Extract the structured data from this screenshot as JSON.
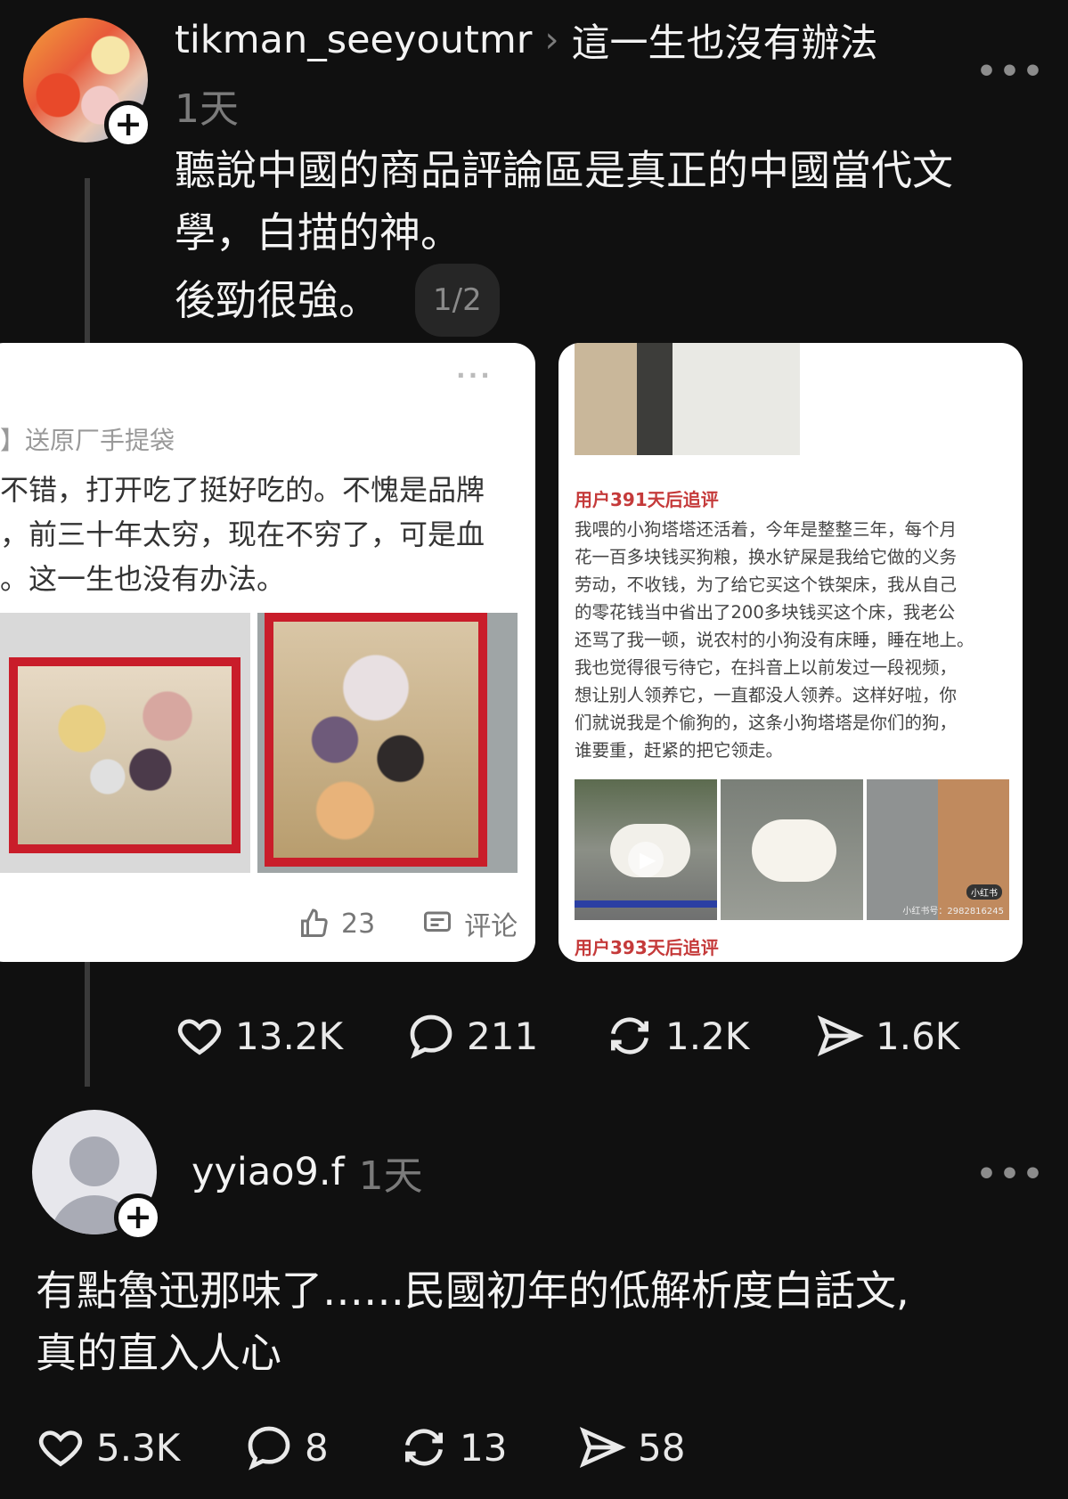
{
  "post": {
    "username": "tikman_seeyoutmr",
    "topic": "這一生也沒有辦法",
    "time": "1天",
    "text_lines": [
      "聽說中國的商品評論區是真正的中國當代文",
      "學，白描的神。",
      "後勁很強。"
    ],
    "image_counter": "1/2",
    "actions": {
      "likes": "13.2K",
      "comments": "211",
      "reposts": "1.2K",
      "shares": "1.6K"
    }
  },
  "card1": {
    "tag": "】送原厂手提袋",
    "lines": [
      "不错，打开吃了挺好吃的。不愧是品牌",
      "，前三十年太穷，现在不穷了，可是血",
      "。这一生也没有办法。"
    ],
    "like_count": "23",
    "comment_label": "评论",
    "more": "···"
  },
  "card2": {
    "label_top": "用户391天后追评",
    "review_lines": [
      "我喂的小狗塔塔还活着，今年是整整三年，每个月",
      "花一百多块钱买狗粮，换水铲屎是我给它做的义务",
      "劳动，不收钱，为了给它买这个铁架床，我从自己",
      "的零花钱当中省出了200多块钱买这个床，我老公",
      "还骂了我一顿，说农村的小狗没有床睡，睡在地上。",
      "我也觉得很亏待它，在抖音上以前发过一段视频，",
      "想让别人领养它，一直都没人领养。这样好啦，你",
      "们就说我是个偷狗的，这条小狗塔塔是你们的狗，",
      "谁要重，赶紧的把它领走。"
    ],
    "watermark_brand": "小红书",
    "watermark_id": "小红书号：2982816245",
    "label_bottom": "用户393天后追评"
  },
  "reply": {
    "username": "yyiao9.f",
    "time": "1天",
    "text_lines": [
      "有點魯迅那味了……民國初年的低解析度白話文,",
      "真的直入人心"
    ],
    "actions": {
      "likes": "5.3K",
      "comments": "8",
      "reposts": "13",
      "shares": "58"
    }
  },
  "colors": {
    "background": "#101010",
    "muted": "#7b7b7b",
    "review_red": "#c53a3a"
  }
}
